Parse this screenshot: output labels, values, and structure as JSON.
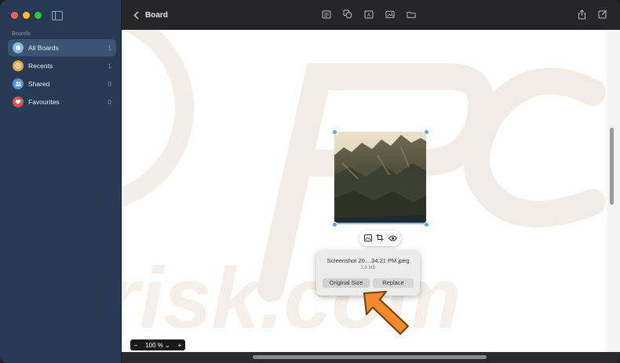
{
  "sidebar": {
    "section": "Boards",
    "items": [
      {
        "label": "All Boards",
        "count": "1",
        "icon": "boards-icon",
        "color": "#7fb8e6"
      },
      {
        "label": "Recents",
        "count": "1",
        "icon": "clock-icon",
        "color": "#e6a64a"
      },
      {
        "label": "Shared",
        "count": "0",
        "icon": "people-icon",
        "color": "#5c8fd8"
      },
      {
        "label": "Favourites",
        "count": "0",
        "icon": "heart-icon",
        "color": "#d9534f"
      }
    ]
  },
  "titlebar": {
    "title": "Board",
    "tools": [
      "note-icon",
      "shapes-icon",
      "text-box-icon",
      "media-icon",
      "folder-icon"
    ],
    "right_tools": [
      "share-icon",
      "edit-icon"
    ]
  },
  "image_popup": {
    "filename": "Screenshot 20....34.21 PM.jpeg",
    "filesize": "3,6 MB",
    "original_size_label": "Original Size",
    "replace_label": "Replace"
  },
  "toolstrip": [
    "image-icon",
    "crop-icon",
    "eye-icon"
  ],
  "zoom": {
    "minus": "−",
    "value": "100 %",
    "chevron": "⌄",
    "plus": "+"
  },
  "colors": {
    "accent": "#5aa3e8",
    "arrow": "#f08a2c"
  }
}
